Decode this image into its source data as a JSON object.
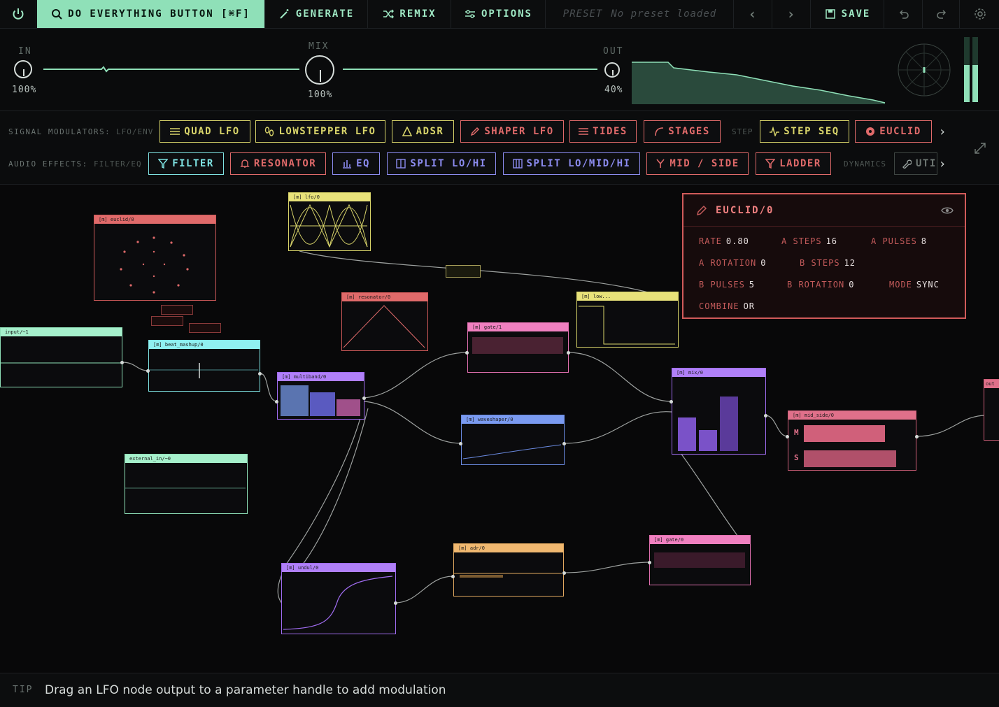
{
  "topbar": {
    "do_everything": "DO EVERYTHING BUTTON [⌘F]",
    "generate": "GENERATE",
    "remix": "REMIX",
    "options": "OPTIONS",
    "preset_label": "PRESET",
    "preset_value": "No preset loaded",
    "prev": "‹",
    "next": "›",
    "save": "SAVE"
  },
  "mixer": {
    "in_label": "IN",
    "in_value": "100%",
    "mix_label": "MIX",
    "mix_value": "100%",
    "out_label": "OUT",
    "out_value": "40%"
  },
  "toolbox": {
    "mod_label": "SIGNAL MODULATORS:",
    "mod_sub": "LFO/ENV",
    "step_sub": "STEP",
    "modulators": [
      {
        "label": "QUAD LFO",
        "color": "#d8d46a"
      },
      {
        "label": "LOWSTEPPER LFO",
        "color": "#d8d46a"
      },
      {
        "label": "ADSR",
        "color": "#d8d46a"
      },
      {
        "label": "SHAPER LFO",
        "color": "#e06a6a"
      },
      {
        "label": "TIDES",
        "color": "#e06a6a"
      },
      {
        "label": "STAGES",
        "color": "#e06a6a"
      },
      {
        "label": "STEP SEQ",
        "color": "#d8d46a"
      },
      {
        "label": "EUCLID",
        "color": "#e06a6a"
      }
    ],
    "fx_label": "AUDIO EFFECTS:",
    "fx_sub": "FILTER/EQ",
    "dyn_sub": "DYNAMICS",
    "effects": [
      {
        "label": "FILTER",
        "color": "#7fe3e3"
      },
      {
        "label": "RESONATOR",
        "color": "#e06a6a"
      },
      {
        "label": "EQ",
        "color": "#8c8cf0"
      },
      {
        "label": "SPLIT LO/HI",
        "color": "#8c8cf0"
      },
      {
        "label": "SPLIT LO/MID/HI",
        "color": "#8c8cf0"
      },
      {
        "label": "MID / SIDE",
        "color": "#e06a6a"
      },
      {
        "label": "LADDER",
        "color": "#e06a6a"
      },
      {
        "label": "UTI",
        "color": "#9aa3a0"
      }
    ]
  },
  "panel": {
    "title": "EUCLID/0",
    "params": [
      {
        "k": "RATE",
        "v": "0.80"
      },
      {
        "k": "A STEPS",
        "v": "16"
      },
      {
        "k": "A PULSES",
        "v": "8"
      },
      {
        "k": "A ROTATION",
        "v": "0"
      },
      {
        "k": "B STEPS",
        "v": "12"
      },
      {
        "k": "B PULSES",
        "v": "5"
      },
      {
        "k": "B ROTATION",
        "v": "0"
      },
      {
        "k": "MODE",
        "v": "SYNC"
      },
      {
        "k": "COMBINE",
        "v": "OR"
      }
    ]
  },
  "nodes": {
    "euclid": "[m] euclid/0",
    "lfo": "[m] lfo/0",
    "input": "input/~1",
    "beat": "[m] beat_mashup/0",
    "resonator": "[m] resonator/0",
    "gate1": "[m] gate/1",
    "low": "[m] low...",
    "multiband": "[m] multiband/0",
    "waveshaper": "[m] waveshaper/0",
    "mix": "[m] mix/0",
    "midside": "[m] mid_side/0",
    "midside_m": "M",
    "midside_s": "S",
    "external": "external_in/~0",
    "undulate": "[m] undul/0",
    "adr": "[m] adr/0",
    "gate0": "[m] gate/0",
    "out": "out"
  },
  "tip": {
    "label": "TIP",
    "text": "Drag an LFO node output to a parameter handle to add modulation"
  },
  "colors": {
    "accent": "#8fe0b8",
    "yellow": "#d8d46a",
    "red": "#d05a5a",
    "cyan": "#7fe3e3",
    "violet": "#8c8cf0",
    "purple": "#a06cf0",
    "pink": "#e070b0",
    "orange": "#e0a860"
  }
}
